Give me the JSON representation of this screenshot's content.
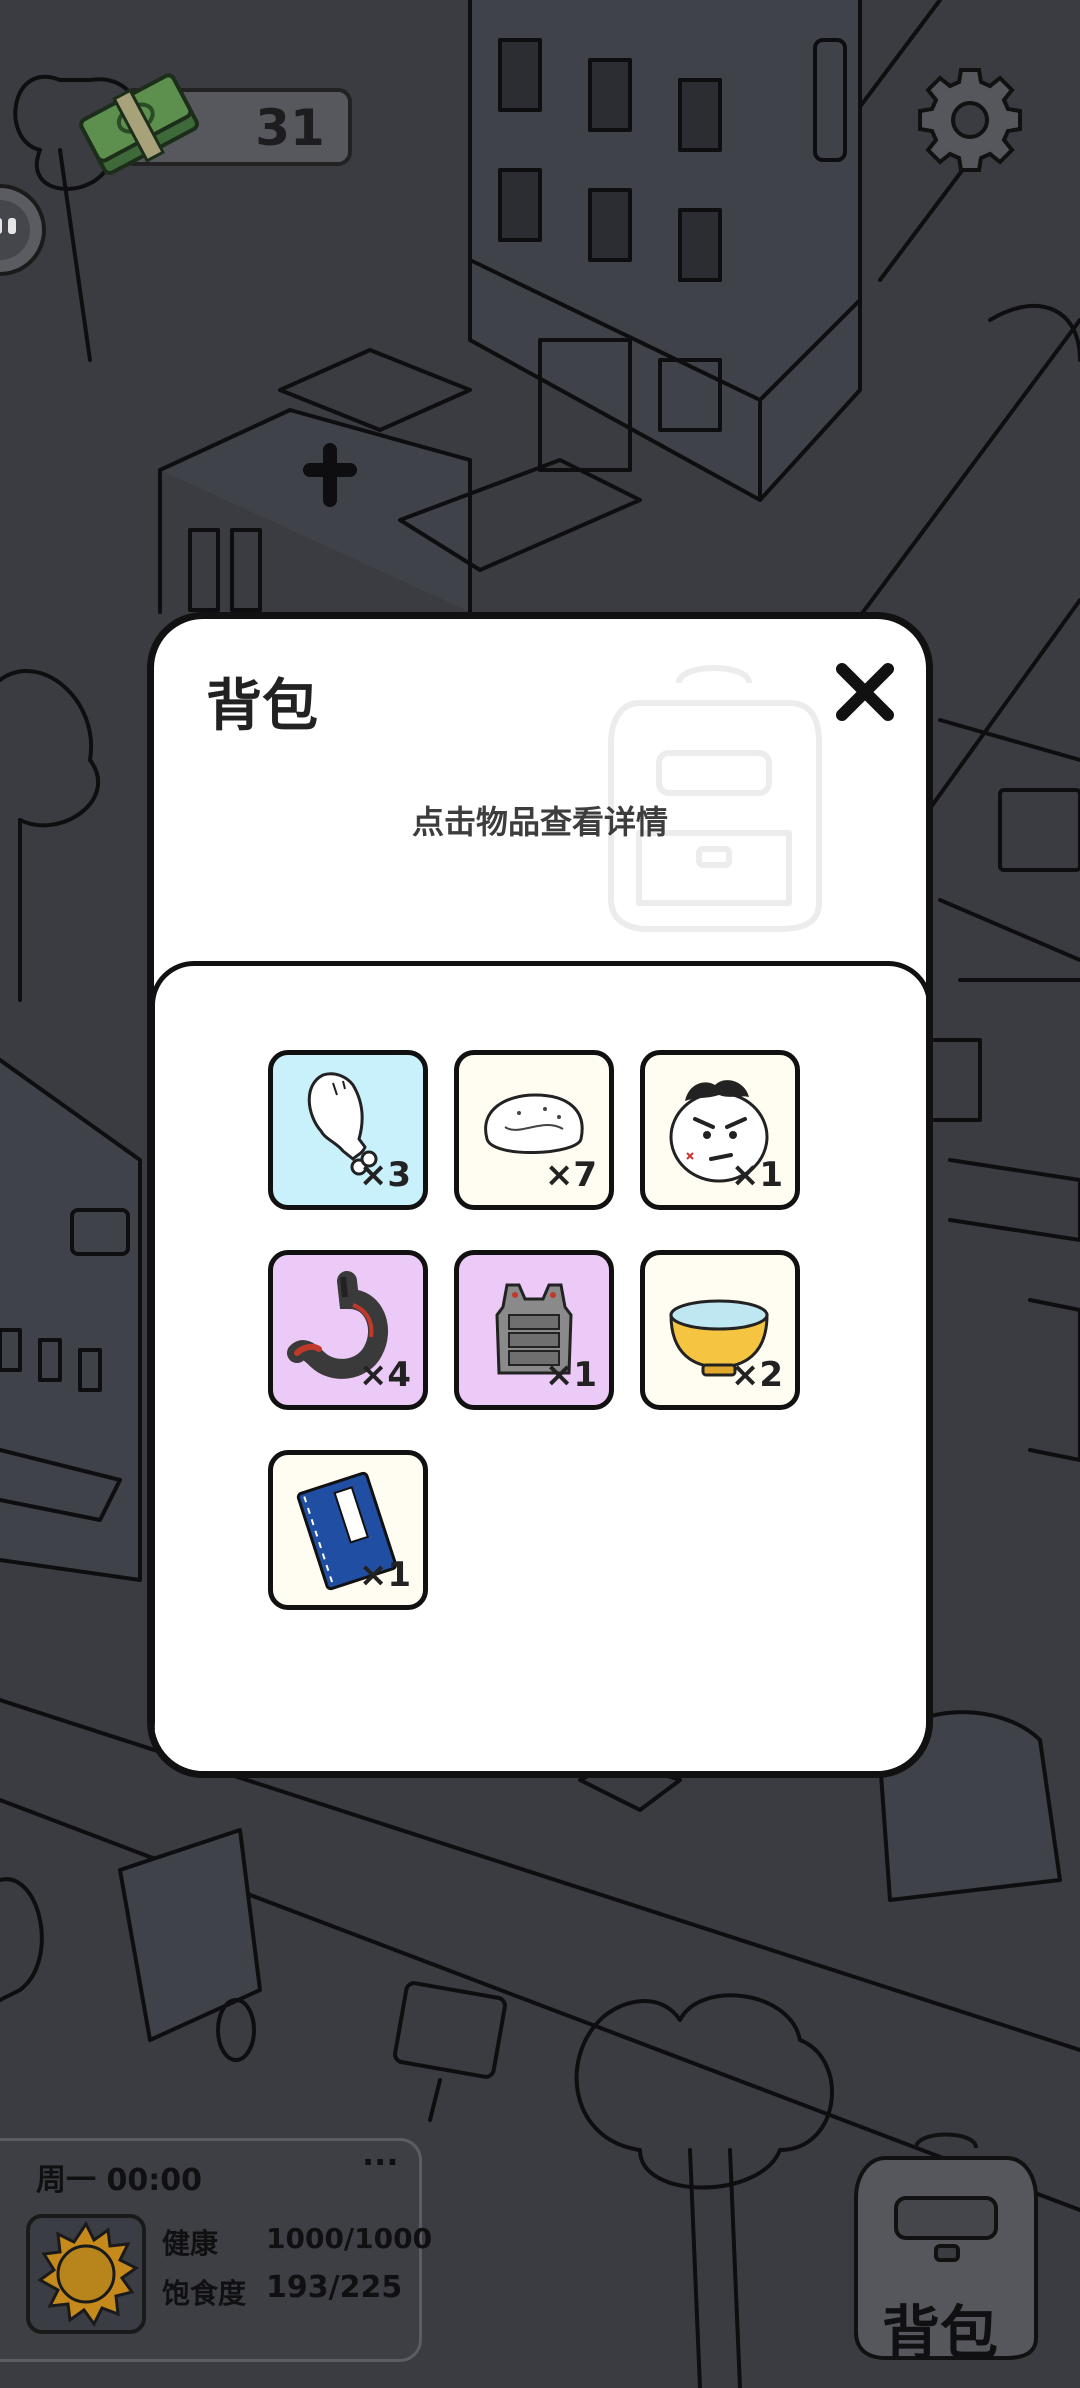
{
  "hud": {
    "money": "31",
    "money_icon": "cash-bundle-icon",
    "settings_icon": "gear-icon",
    "side_icon": "chat-bubble-icon"
  },
  "inventory": {
    "title": "背包",
    "hint": "点击物品查看详情",
    "close_icon": "close-icon",
    "items": [
      {
        "icon": "chicken-drumstick-icon",
        "qty": "×3",
        "bg": "#c9f1fc"
      },
      {
        "icon": "bread-bun-icon",
        "qty": "×7",
        "bg": "#fffdf1"
      },
      {
        "icon": "angry-face-icon",
        "qty": "×1",
        "bg": "#fffdf1"
      },
      {
        "icon": "stomach-organ-icon",
        "qty": "×4",
        "bg": "#eccaf8"
      },
      {
        "icon": "body-armor-vest-icon",
        "qty": "×1",
        "bg": "#eccaf8"
      },
      {
        "icon": "water-bowl-icon",
        "qty": "×2",
        "bg": "#fffdf1"
      },
      {
        "icon": "blue-book-icon",
        "qty": "×1",
        "bg": "#fffdf1"
      }
    ]
  },
  "status": {
    "day_time": "周一 00:00",
    "more": "···",
    "weather_icon": "sun-icon",
    "health_label": "健康",
    "health_value": "1000/1000",
    "satiety_label": "饱食度",
    "satiety_value": "193/225"
  },
  "backpack_button": {
    "label": "背包",
    "icon": "backpack-icon"
  },
  "colors": {
    "modal_bg": "#ffffff",
    "outline": "#111111",
    "common_slot": "#fffdf1",
    "food_slot": "#c9f1fc",
    "rare_slot": "#eccaf8",
    "background": "#3a3c42"
  }
}
